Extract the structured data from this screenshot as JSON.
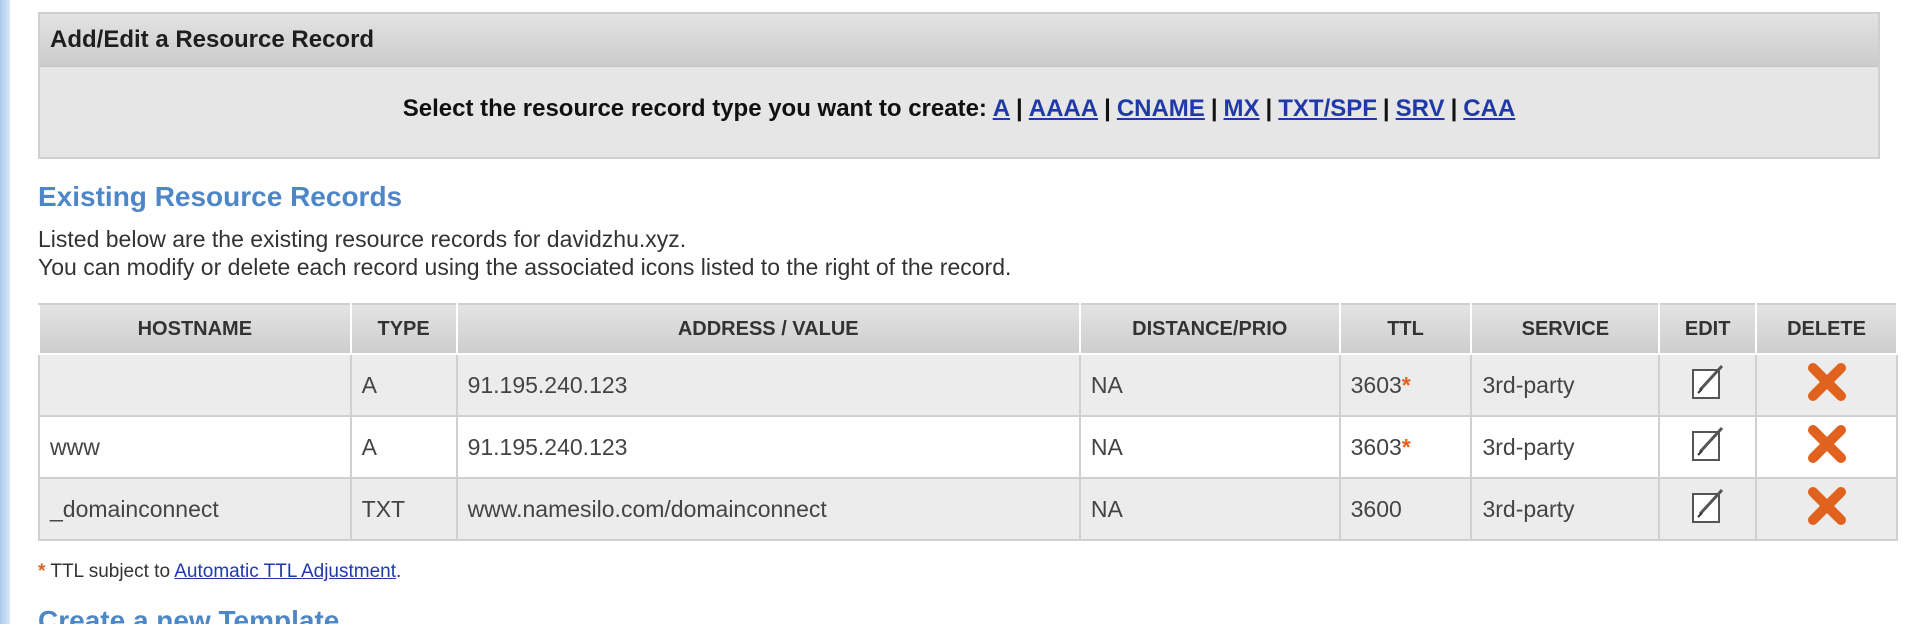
{
  "panel": {
    "title": "Add/Edit a Resource Record",
    "prompt": "Select the resource record type you want to create:",
    "types": [
      "A",
      "AAAA",
      "CNAME",
      "MX",
      "TXT/SPF",
      "SRV",
      "CAA"
    ]
  },
  "existing": {
    "title": "Existing Resource Records",
    "desc_line1": "Listed below are the existing resource records for davidzhu.xyz.",
    "desc_line2": "You can modify or delete each record using the associated icons listed to the right of the record."
  },
  "table": {
    "columns": [
      "HOSTNAME",
      "TYPE",
      "ADDRESS / VALUE",
      "DISTANCE/PRIO",
      "TTL",
      "SERVICE",
      "EDIT",
      "DELETE"
    ],
    "rows": [
      {
        "hostname": "",
        "type": "A",
        "value": "91.195.240.123",
        "prio": "NA",
        "ttl": "3603",
        "ttl_star": "*",
        "service": "3rd-party"
      },
      {
        "hostname": "www",
        "type": "A",
        "value": "91.195.240.123",
        "prio": "NA",
        "ttl": "3603",
        "ttl_star": "*",
        "service": "3rd-party"
      },
      {
        "hostname": "_domainconnect",
        "type": "TXT",
        "value": "www.namesilo.com/domainconnect",
        "prio": "NA",
        "ttl": "3600",
        "ttl_star": "",
        "service": "3rd-party"
      }
    ]
  },
  "footnote": {
    "star": "*",
    "text": " TTL subject to ",
    "link": "Automatic TTL Adjustment",
    "end": "."
  },
  "next_section": {
    "title": "Create a new Template"
  },
  "colors": {
    "accent_blue": "#4d87c7",
    "link_blue": "#1f3aa8",
    "delete_orange": "#e0621e"
  },
  "icons": {
    "edit": "edit-pencil-icon",
    "delete": "delete-x-icon"
  }
}
